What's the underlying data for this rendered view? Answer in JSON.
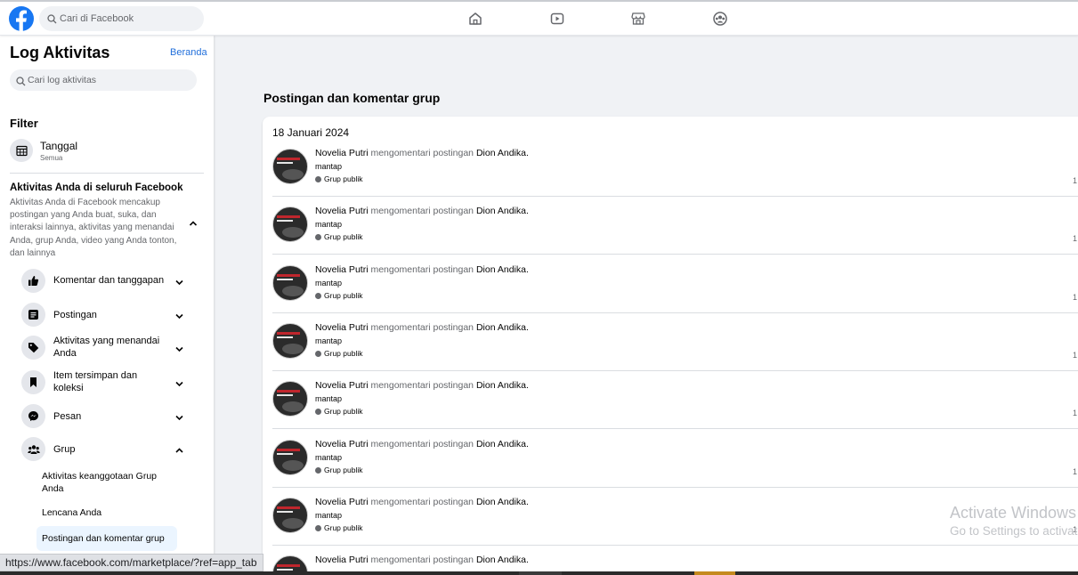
{
  "topbar": {
    "search_placeholder": "Cari di Facebook",
    "nav_icons": [
      "home-icon",
      "watch-icon",
      "marketplace-icon",
      "groups-icon"
    ]
  },
  "sidebar": {
    "title": "Log Aktivitas",
    "home_link": "Beranda",
    "search_placeholder": "Cari log aktivitas",
    "filter_heading": "Filter",
    "date_filter": {
      "label": "Tanggal",
      "value": "Semua"
    },
    "section_title": "Aktivitas Anda di seluruh Facebook",
    "section_desc": "Aktivitas Anda di Facebook mencakup postingan yang Anda buat, suka, dan interaksi lainnya, aktivitas yang menandai Anda, grup Anda, video yang Anda tonton, dan lainnya",
    "categories": [
      {
        "label": "Komentar dan tanggapan",
        "icon": "thumbs-up-icon",
        "expanded": false
      },
      {
        "label": "Postingan",
        "icon": "post-icon",
        "expanded": false
      },
      {
        "label": "Aktivitas yang menandai Anda",
        "icon": "tag-icon",
        "expanded": false
      },
      {
        "label": "Item tersimpan dan koleksi",
        "icon": "bookmark-icon",
        "expanded": false
      },
      {
        "label": "Pesan",
        "icon": "messenger-icon",
        "expanded": false
      },
      {
        "label": "Grup",
        "icon": "group-icon",
        "expanded": true
      }
    ],
    "group_subitems": [
      {
        "label": "Aktivitas keanggotaan Grup Anda",
        "active": false
      },
      {
        "label": "Lencana Anda",
        "active": false
      },
      {
        "label": "Postingan dan komentar grup",
        "active": true
      }
    ]
  },
  "main": {
    "title": "Postingan dan komentar grup",
    "date": "18 Januari 2024",
    "entries": [
      {
        "actor": "Novelia Putri",
        "action": " mengomentari postingan ",
        "target": "Dion Andika",
        "comment": "mantap",
        "privacy": "Grup publik",
        "trail": "1"
      },
      {
        "actor": "Novelia Putri",
        "action": " mengomentari postingan ",
        "target": "Dion Andika",
        "comment": "mantap",
        "privacy": "Grup publik",
        "trail": "1"
      },
      {
        "actor": "Novelia Putri",
        "action": " mengomentari postingan ",
        "target": "Dion Andika",
        "comment": "mantap",
        "privacy": "Grup publik",
        "trail": "1"
      },
      {
        "actor": "Novelia Putri",
        "action": " mengomentari postingan ",
        "target": "Dion Andika",
        "comment": "mantap",
        "privacy": "Grup publik",
        "trail": "1"
      },
      {
        "actor": "Novelia Putri",
        "action": " mengomentari postingan ",
        "target": "Dion Andika",
        "comment": "mantap",
        "privacy": "Grup publik",
        "trail": "1"
      },
      {
        "actor": "Novelia Putri",
        "action": " mengomentari postingan ",
        "target": "Dion Andika",
        "comment": "mantap",
        "privacy": "Grup publik",
        "trail": "1"
      },
      {
        "actor": "Novelia Putri",
        "action": " mengomentari postingan ",
        "target": "Dion Andika",
        "comment": "mantap",
        "privacy": "Grup publik",
        "trail": "1"
      },
      {
        "actor": "Novelia Putri",
        "action": " mengomentari postingan ",
        "target": "Dion Andika",
        "comment": "",
        "privacy": "",
        "trail": ""
      }
    ]
  },
  "watermark": {
    "line1": "Activate Windows",
    "line2": "Go to Settings to activate Windows."
  },
  "status_url": "https://www.facebook.com/marketplace/?ref=app_tab",
  "colors": {
    "brand": "#1877f2",
    "link": "#216fdb",
    "active_bg": "#ebf5ff"
  }
}
